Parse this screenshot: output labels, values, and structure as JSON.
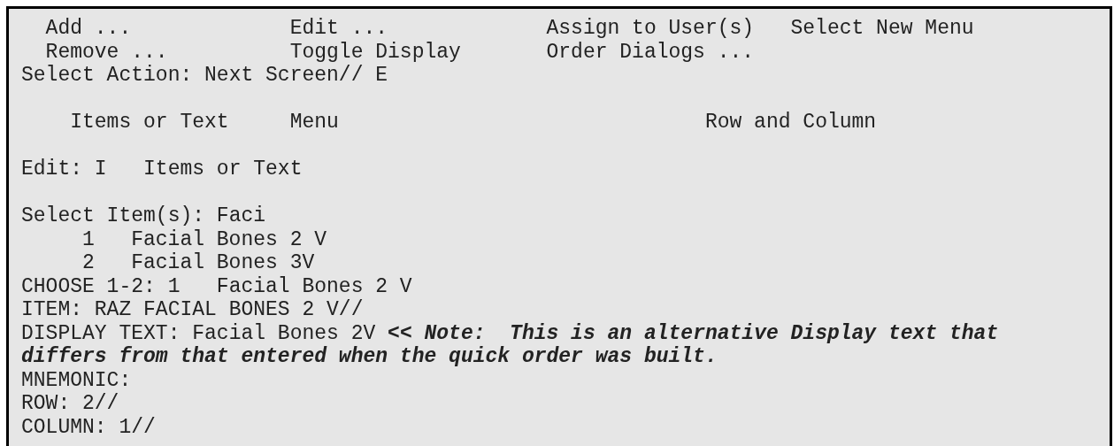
{
  "menu_actions": [
    {
      "label": "Add ..."
    },
    {
      "label": "Edit ..."
    },
    {
      "label": "Assign to User(s)"
    },
    {
      "label": "Select New Menu"
    },
    {
      "label": "Remove ..."
    },
    {
      "label": "Toggle Display"
    },
    {
      "label": "Order Dialogs ..."
    }
  ],
  "select_action": {
    "prompt": "Select Action:",
    "value": "Next Screen// E"
  },
  "edit_options": [
    "Items or Text",
    "Menu",
    "Row and Column"
  ],
  "edit_line": "Edit: I   Items or Text",
  "select_items": {
    "prompt": "Select Item(s):",
    "value": "Faci"
  },
  "matches": [
    {
      "number": "1",
      "label": "Facial Bones 2 V"
    },
    {
      "number": "2",
      "label": "Facial Bones 3V"
    }
  ],
  "choose_line": "CHOOSE 1-2: 1   Facial Bones 2 V",
  "item_line": "ITEM: RAZ FACIAL BONES 2 V//",
  "display_text": {
    "text": "DISPLAY TEXT: Facial Bones 2V ",
    "note": "<< Note:  This is an alternative Display text that differs from that entered when the quick order was built."
  },
  "fields": [
    "MNEMONIC:",
    "ROW: 2//",
    "COLUMN: 1//"
  ]
}
